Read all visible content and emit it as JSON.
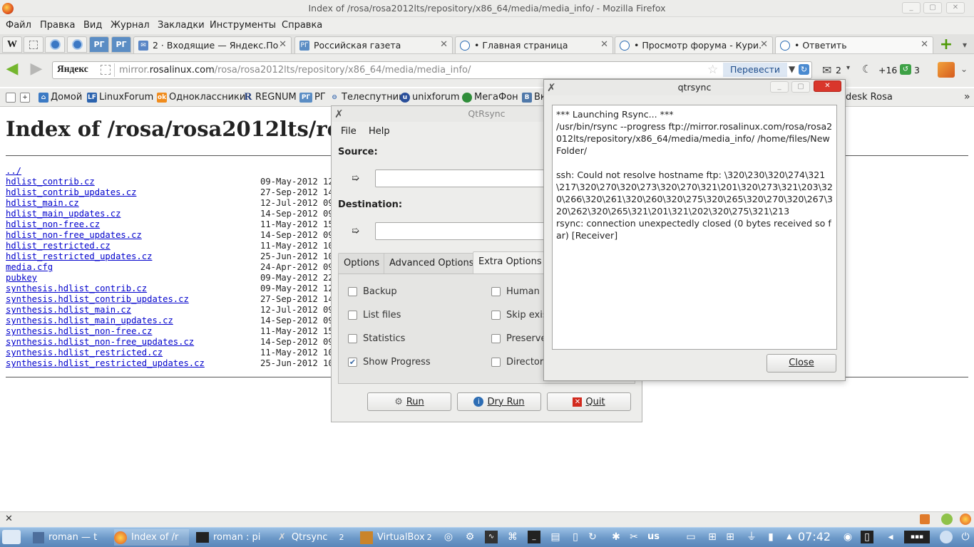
{
  "window": {
    "title": "Index of /rosa/rosa2012lts/repository/x86_64/media/media_info/ - Mozilla Firefox"
  },
  "menu": [
    "Файл",
    "Правка",
    "Вид",
    "Журнал",
    "Закладки",
    "Инструменты",
    "Справка"
  ],
  "pinned_tabs": [
    {
      "icon": "W",
      "name": "wikipedia"
    },
    {
      "icon": "",
      "name": "blank"
    },
    {
      "icon": "",
      "name": "app-a"
    },
    {
      "icon": "",
      "name": "app-b"
    },
    {
      "icon": "РГ",
      "name": "rg-a"
    },
    {
      "icon": "РГ",
      "name": "rg-b"
    }
  ],
  "tabs": [
    {
      "label": "2 · Входящие — Яндекс.По…"
    },
    {
      "label": "Российская газета"
    },
    {
      "label": "• Главная страница"
    },
    {
      "label": "• Просмотр форума - Кури…"
    },
    {
      "label": "• Ответить"
    }
  ],
  "navbar": {
    "search_engine": "Яндекс",
    "url_prefix": "mirror.",
    "url_domain": "rosalinux.com",
    "url_path": "/rosa/rosa2012lts/repository/x86_64/media/media_info/",
    "translate_label": "Перевести",
    "mail_count": "2",
    "weather": "+16",
    "notify_count": "3"
  },
  "bookmarks": [
    "Домой",
    "LinuxForum",
    "Одноклассники",
    "REGNUM",
    "РГ",
    "Телеспутник",
    "unixforum",
    "МегаФон",
    "Вк",
    "desk Rosa"
  ],
  "page": {
    "heading": "Index of /rosa/rosa2012lts/reposit",
    "parent_link": "../",
    "files": [
      {
        "name": "hdlist_contrib.cz",
        "date": "09-May-2012 12"
      },
      {
        "name": "hdlist_contrib_updates.cz",
        "date": "27-Sep-2012 14"
      },
      {
        "name": "hdlist_main.cz",
        "date": "12-Jul-2012 09"
      },
      {
        "name": "hdlist_main_updates.cz",
        "date": "14-Sep-2012 09"
      },
      {
        "name": "hdlist_non-free.cz",
        "date": "11-May-2012 15"
      },
      {
        "name": "hdlist_non-free_updates.cz",
        "date": "14-Sep-2012 09"
      },
      {
        "name": "hdlist_restricted.cz",
        "date": "11-May-2012 10"
      },
      {
        "name": "hdlist_restricted_updates.cz",
        "date": "25-Jun-2012 10"
      },
      {
        "name": "media.cfg",
        "date": "24-Apr-2012 09"
      },
      {
        "name": "pubkey",
        "date": "09-May-2012 22"
      },
      {
        "name": "synthesis.hdlist_contrib.cz",
        "date": "09-May-2012 12"
      },
      {
        "name": "synthesis.hdlist_contrib_updates.cz",
        "date": "27-Sep-2012 14"
      },
      {
        "name": "synthesis.hdlist_main.cz",
        "date": "12-Jul-2012 09"
      },
      {
        "name": "synthesis.hdlist_main_updates.cz",
        "date": "14-Sep-2012 09"
      },
      {
        "name": "synthesis.hdlist_non-free.cz",
        "date": "11-May-2012 15"
      },
      {
        "name": "synthesis.hdlist_non-free_updates.cz",
        "date": "14-Sep-2012 09"
      },
      {
        "name": "synthesis.hdlist_restricted.cz",
        "date": "11-May-2012 10"
      },
      {
        "name": "synthesis.hdlist_restricted_updates.cz",
        "date": "25-Jun-2012 10"
      }
    ]
  },
  "qtrsync": {
    "title": "QtRsync",
    "menu": [
      "File",
      "Help"
    ],
    "source_label": "Source:",
    "destination_label": "Destination:",
    "source_value": "",
    "destination_value": "",
    "tabs": [
      "Options",
      "Advanced Options",
      "Extra Options"
    ],
    "active_tab": "Extra Options",
    "left_options": [
      {
        "label": "Backup",
        "checked": false
      },
      {
        "label": "List files",
        "checked": false
      },
      {
        "label": "Statistics",
        "checked": false
      },
      {
        "label": "Show Progress",
        "checked": true
      }
    ],
    "right_options": [
      {
        "label": "Human r",
        "checked": false
      },
      {
        "label": "Skip exis",
        "checked": false
      },
      {
        "label": "Preserve",
        "checked": false
      },
      {
        "label": "Directori",
        "checked": false
      }
    ],
    "buttons": {
      "run": "Run",
      "dry_run": "Dry Run",
      "quit": "Quit"
    }
  },
  "output_dialog": {
    "title": "qtrsync",
    "lines": [
      "*** Launching Rsync... ***",
      "/usr/bin/rsync --progress ftp://mirror.rosalinux.com/rosa/rosa2012lts/repository/x86_64/media/media_info/ /home/files/New Folder/",
      "",
      "ssh: Could not resolve hostname ftp: \\320\\230\\320\\274\\321\\217\\320\\270\\320\\273\\320\\270\\321\\201\\320\\273\\321\\203\\320\\266\\320\\261\\320\\260\\320\\275\\320\\265\\320\\270\\320\\267\\320\\262\\320\\265\\321\\201\\321\\202\\320\\275\\321\\213",
      "rsync: connection unexpectedly closed (0 bytes received so far) [Receiver]"
    ],
    "close_label": "Close"
  },
  "taskbar": {
    "tasks": [
      "roman — t",
      "Index of /r",
      "roman : pi",
      "Qtrsync",
      "VirtualBox"
    ],
    "task_counts": {
      "qtrsync": "2",
      "virtualbox": "2"
    },
    "keyboard_layout": "us",
    "clock": "07:42"
  },
  "colors": {
    "link": "#0000cc",
    "taskbar": "#6b98c8",
    "accent_green": "#74b62e"
  }
}
